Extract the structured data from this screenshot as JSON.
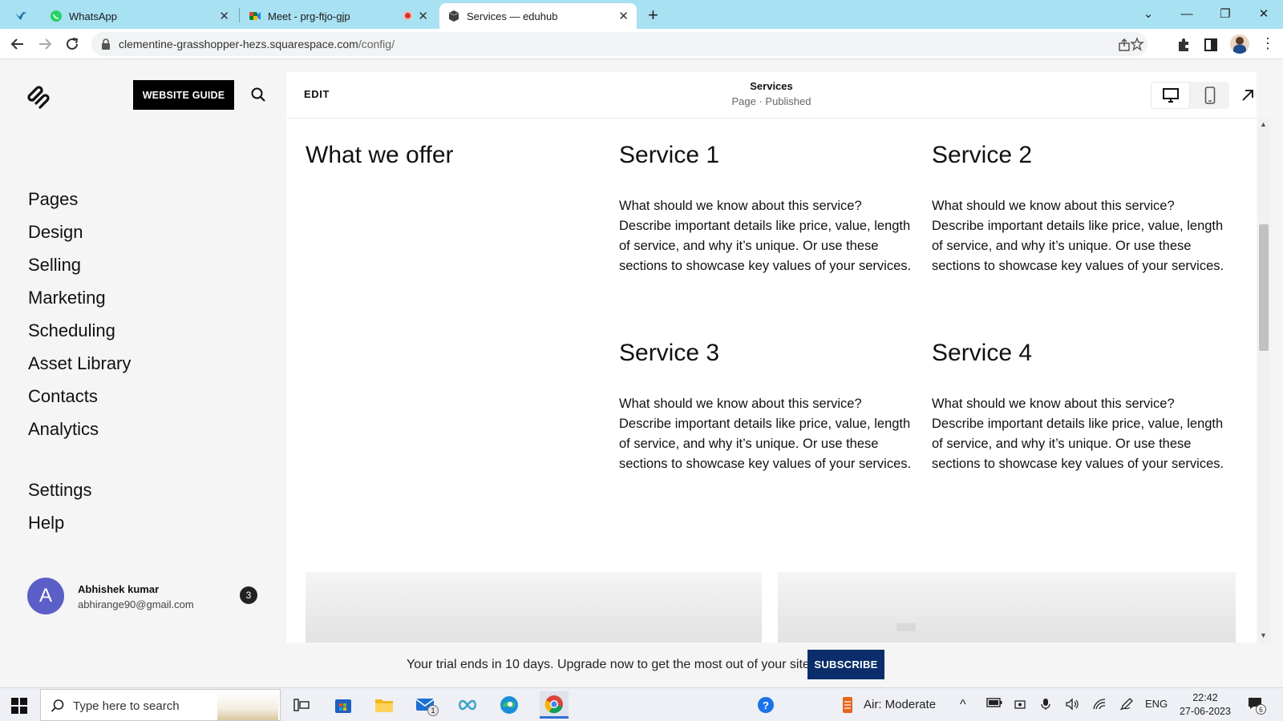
{
  "browser": {
    "tabs": [
      {
        "title": "",
        "icon": "bird-icon"
      },
      {
        "title": "WhatsApp",
        "icon": "whatsapp-icon"
      },
      {
        "title": "Meet - prg-ftjo-gjp",
        "icon": "meet-icon"
      },
      {
        "title": "Services — eduhub",
        "icon": "squarespace-cube-icon",
        "active": true
      }
    ],
    "url_host": "clementine-grasshopper-hezs.squarespace.com",
    "url_path": "/config/"
  },
  "sidebar": {
    "guide_button": "WEBSITE GUIDE",
    "nav": [
      "Pages",
      "Design",
      "Selling",
      "Marketing",
      "Scheduling",
      "Asset Library",
      "Contacts",
      "Analytics"
    ],
    "nav_secondary": [
      "Settings",
      "Help"
    ],
    "account": {
      "initial": "A",
      "name": "Abhishek kumar",
      "email": "abhirange90@gmail.com",
      "notifications": "3"
    }
  },
  "editor": {
    "edit_label": "EDIT",
    "page_title": "Services",
    "page_status": "Page · Published",
    "section_title": "What we offer",
    "services": [
      {
        "title": "Service 1",
        "text": "What should we know about this service? Describe important details like price, value, length of service, and why it’s unique. Or use these sections to showcase key values of your services."
      },
      {
        "title": "Service 2",
        "text": "What should we know about this service? Describe important details like price, value, length of service, and why it’s unique. Or use these sections to showcase key values of your services."
      },
      {
        "title": "Service 3",
        "text": "What should we know about this service? Describe important details like price, value, length of service, and why it’s unique. Or use these sections to showcase key values of your services."
      },
      {
        "title": "Service 4",
        "text": "What should we know about this service? Describe important details like price, value, length of service, and why it’s unique. Or use these sections to showcase key values of your services."
      }
    ]
  },
  "banner": {
    "text": "Your trial ends in 10 days. Upgrade now to get the most out of your site.",
    "button": "SUBSCRIBE"
  },
  "taskbar": {
    "search_placeholder": "Type here to search",
    "weather": "Air: Moderate",
    "language": "ENG",
    "time": "22:42",
    "date": "27-06-2023",
    "mail_badge": "1",
    "notification_badge": "6"
  },
  "colors": {
    "tabbar": "#a8e1f2",
    "subscribe": "#0b2d6b",
    "avatar": "#5b5fc7"
  }
}
